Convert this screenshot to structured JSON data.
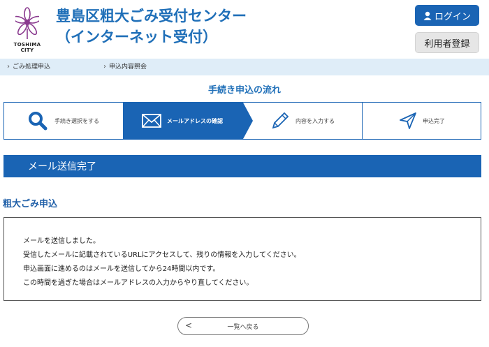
{
  "header": {
    "title_line1": "豊島区粗大ごみ受付センター",
    "title_line2": "（インターネット受付）",
    "logo_text": "TOSHIMA CITY",
    "login_label": "ログイン",
    "register_label": "利用者登録"
  },
  "nav": {
    "items": [
      {
        "label": "ごみ処理申込"
      },
      {
        "label": "申込内容照会"
      }
    ]
  },
  "flow": {
    "title": "手続き申込の流れ",
    "steps": [
      {
        "label": "手続き選択をする",
        "icon": "search-icon",
        "active": false
      },
      {
        "label": "メールアドレスの確認",
        "icon": "envelope-icon",
        "active": true
      },
      {
        "label": "内容を入力する",
        "icon": "pencil-icon",
        "active": false
      },
      {
        "label": "申込完了",
        "icon": "send-icon",
        "active": false
      }
    ]
  },
  "banner": {
    "label": "メール送信完了"
  },
  "section": {
    "title": "粗大ごみ申込"
  },
  "message": {
    "lines": [
      "メールを送信しました。",
      "受信したメールに記載されているURLにアクセスして、残りの情報を入力してください。",
      "申込画面に進めるのはメールを送信してから24時間以内です。",
      "この時間を過ぎた場合はメールアドレスの入力からやり直してください。"
    ]
  },
  "back": {
    "label": "一覧へ戻る",
    "glyph": "<"
  },
  "colors": {
    "primary": "#1a64b4",
    "title": "#1f6fb8",
    "nav_bg": "#dfedf8"
  }
}
